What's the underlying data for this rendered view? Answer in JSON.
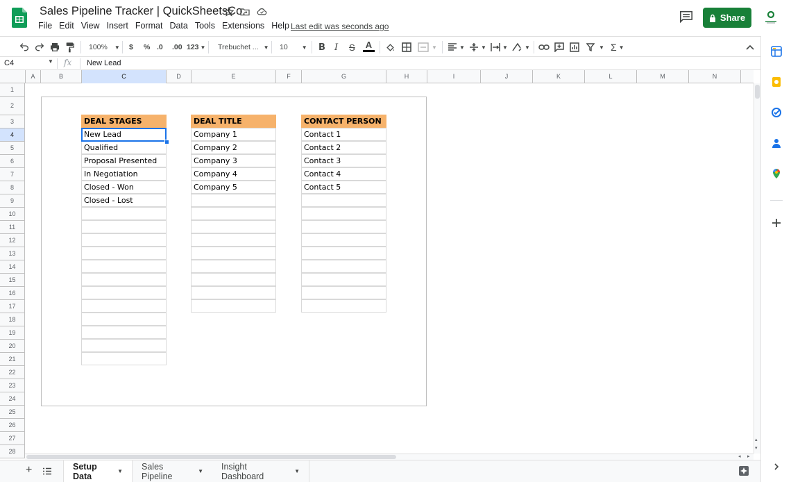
{
  "app": {
    "doc_title": "Sales Pipeline Tracker | QuickSheetsCo.",
    "menu": [
      "File",
      "Edit",
      "View",
      "Insert",
      "Format",
      "Data",
      "Tools",
      "Extensions",
      "Help"
    ],
    "last_edit": "Last edit was seconds ago",
    "share_label": "Share"
  },
  "toolbar": {
    "zoom": "100%",
    "currency": "$",
    "percent": "%",
    "dec_decrease": ".0",
    "dec_increase": ".00",
    "more_formats": "123",
    "font": "Trebuchet ...",
    "font_size": "10"
  },
  "formula_bar": {
    "cell_ref": "C4",
    "fx": "fx",
    "value": "New Lead"
  },
  "grid": {
    "columns": [
      "A",
      "B",
      "C",
      "D",
      "E",
      "F",
      "G",
      "H",
      "I",
      "J",
      "K",
      "L",
      "M",
      "N"
    ],
    "rows": [
      "1",
      "2",
      "3",
      "4",
      "5",
      "6",
      "7",
      "8",
      "9",
      "10",
      "11",
      "12",
      "13",
      "14",
      "15",
      "16",
      "17",
      "18",
      "19",
      "20",
      "21",
      "22",
      "23",
      "24",
      "25",
      "26",
      "27",
      "28"
    ],
    "selected_column": "C",
    "selected_row": "4"
  },
  "tables": {
    "deal_stages": {
      "header": "DEAL STAGES",
      "items": [
        "New Lead",
        "Qualified",
        "Proposal Presented",
        "In Negotiation",
        "Closed - Won",
        "Closed - Lost",
        "",
        "",
        "",
        "",
        "",
        "",
        "",
        "",
        "",
        "",
        "",
        ""
      ]
    },
    "deal_title": {
      "header": "DEAL TITLE",
      "items": [
        "Company 1",
        "Company 2",
        "Company 3",
        "Company 4",
        "Company 5",
        "",
        "",
        "",
        "",
        "",
        "",
        "",
        "",
        ""
      ]
    },
    "contact_person": {
      "header": "CONTACT PERSON",
      "items": [
        "Contact 1",
        "Contact 2",
        "Contact 3",
        "Contact 4",
        "Contact 5",
        "",
        "",
        "",
        "",
        "",
        "",
        "",
        "",
        ""
      ]
    }
  },
  "sheets": {
    "tabs": [
      "Setup Data",
      "Sales Pipeline",
      "Insight Dashboard"
    ],
    "active": "Setup Data"
  },
  "colors": {
    "header_fill": "#f6b26b",
    "share_button": "#188038",
    "selection": "#1a73e8"
  }
}
